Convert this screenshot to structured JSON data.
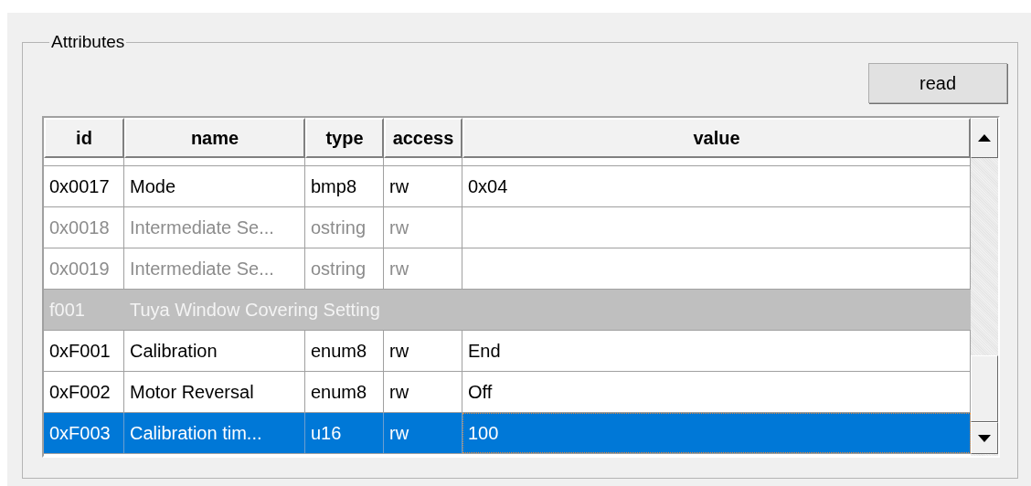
{
  "group_box": {
    "title": "Attributes"
  },
  "read_button": {
    "label": "read"
  },
  "table": {
    "columns": [
      "id",
      "name",
      "type",
      "access",
      "value"
    ],
    "rows": [
      {
        "kind": "attribute",
        "id": "0x0017",
        "name": "Mode",
        "type": "bmp8",
        "access": "rw",
        "value": "0x04",
        "disabled": false,
        "selected": false
      },
      {
        "kind": "attribute",
        "id": "0x0018",
        "name": "Intermediate Se...",
        "type": "ostring",
        "access": "rw",
        "disabled": true,
        "selected": false
      },
      {
        "kind": "attribute",
        "id": "0x0019",
        "name": "Intermediate Se...",
        "type": "ostring",
        "access": "rw",
        "disabled": true,
        "selected": false
      },
      {
        "kind": "group",
        "id": "f001",
        "name": "Tuya Window Covering Setting",
        "selected": false
      },
      {
        "kind": "attribute",
        "id": "0xF001",
        "name": "Calibration",
        "type": "enum8",
        "access": "rw",
        "value": "End",
        "disabled": false,
        "selected": false
      },
      {
        "kind": "attribute",
        "id": "0xF002",
        "name": "Motor Reversal",
        "type": "enum8",
        "access": "rw",
        "value": "Off",
        "disabled": false,
        "selected": false
      },
      {
        "kind": "attribute",
        "id": "0xF003",
        "name": "Calibration tim...",
        "type": "u16",
        "access": "rw",
        "value": "100",
        "disabled": false,
        "selected": true
      }
    ]
  }
}
